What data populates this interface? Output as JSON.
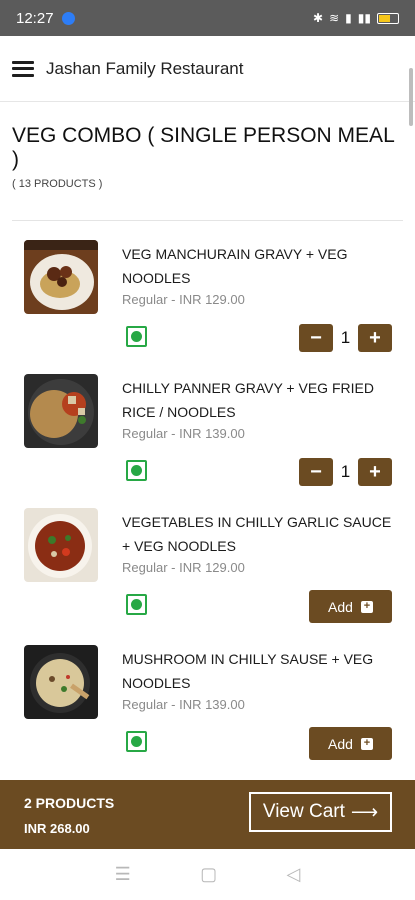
{
  "status_bar": {
    "time": "12:27"
  },
  "app_bar": {
    "title": "Jashan Family Restaurant"
  },
  "category": {
    "title": "VEG COMBO ( SINGLE PERSON MEAL )",
    "count": "( 13 PRODUCTS )"
  },
  "items": [
    {
      "name": "VEG MANCHURAIN GRAVY + VEG NOODLES",
      "price": "Regular - INR 129.00",
      "quantity": "1"
    },
    {
      "name": "CHILLY PANNER GRAVY + VEG FRIED RICE / NOODLES",
      "price": "Regular - INR 139.00",
      "quantity": "1"
    },
    {
      "name": "VEGETABLES IN CHILLY GARLIC SAUCE + VEG NOODLES",
      "price": "Regular - INR 129.00",
      "add_label": "Add"
    },
    {
      "name": "MUSHROOM IN CHILLY SAUSE + VEG NOODLES",
      "price": "Regular - INR 139.00",
      "add_label": "Add"
    }
  ],
  "stepper": {
    "minus": "−",
    "plus": "+"
  },
  "cart": {
    "count": "2 PRODUCTS",
    "total": "INR 268.00",
    "button_label": "View Cart",
    "arrow": "⟶"
  },
  "nav": {
    "menu": "☰",
    "home": "▢",
    "back": "◁"
  },
  "colors": {
    "accent": "#6b4b22",
    "veg_green": "#27a845",
    "status_bar": "#5b5b5b"
  },
  "icons": [
    "hamburger-icon",
    "veg-mark-icon",
    "minus-icon",
    "plus-icon",
    "add-plus-icon",
    "arrow-right-icon"
  ]
}
